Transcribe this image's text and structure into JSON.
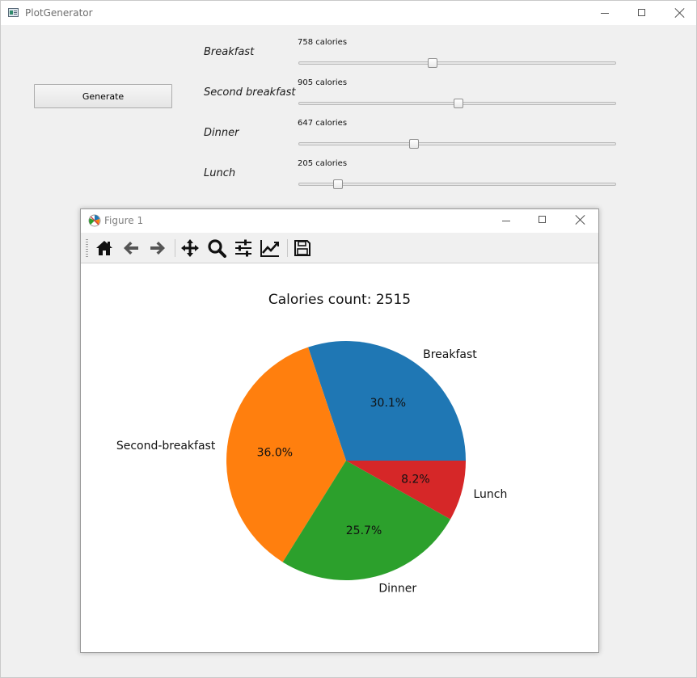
{
  "window": {
    "title": "PlotGenerator"
  },
  "generate_button": {
    "label": "Generate"
  },
  "meals": [
    {
      "name": "Breakfast",
      "calories_text": "758 calories",
      "value": 758
    },
    {
      "name": "Second breakfast",
      "calories_text": "905 calories",
      "value": 905
    },
    {
      "name": "Dinner",
      "calories_text": "647 calories",
      "value": 647
    },
    {
      "name": "Lunch",
      "calories_text": "205 calories",
      "value": 205
    }
  ],
  "slider": {
    "min": 0,
    "max": 1800
  },
  "figure_window": {
    "title": "Figure 1",
    "toolbar": [
      "home-icon",
      "back-arrow-icon",
      "forward-arrow-icon",
      "pan-move-icon",
      "zoom-magnifier-icon",
      "configure-subplots-icon",
      "edit-axes-icon",
      "save-floppy-icon"
    ]
  },
  "chart_data": {
    "type": "pie",
    "title": "Calories count: 2515",
    "slices": [
      {
        "label": "Breakfast",
        "value": 758,
        "pct_label": "30.1%",
        "color": "#1f77b4"
      },
      {
        "label": "Second-breakfast",
        "value": 905,
        "pct_label": "36.0%",
        "color": "#ff7f0e"
      },
      {
        "label": "Dinner",
        "value": 647,
        "pct_label": "25.7%",
        "color": "#2ca02c"
      },
      {
        "label": "Lunch",
        "value": 205,
        "pct_label": "8.2%",
        "color": "#d62728"
      }
    ],
    "start_angle": 0,
    "direction": "counterclockwise"
  }
}
